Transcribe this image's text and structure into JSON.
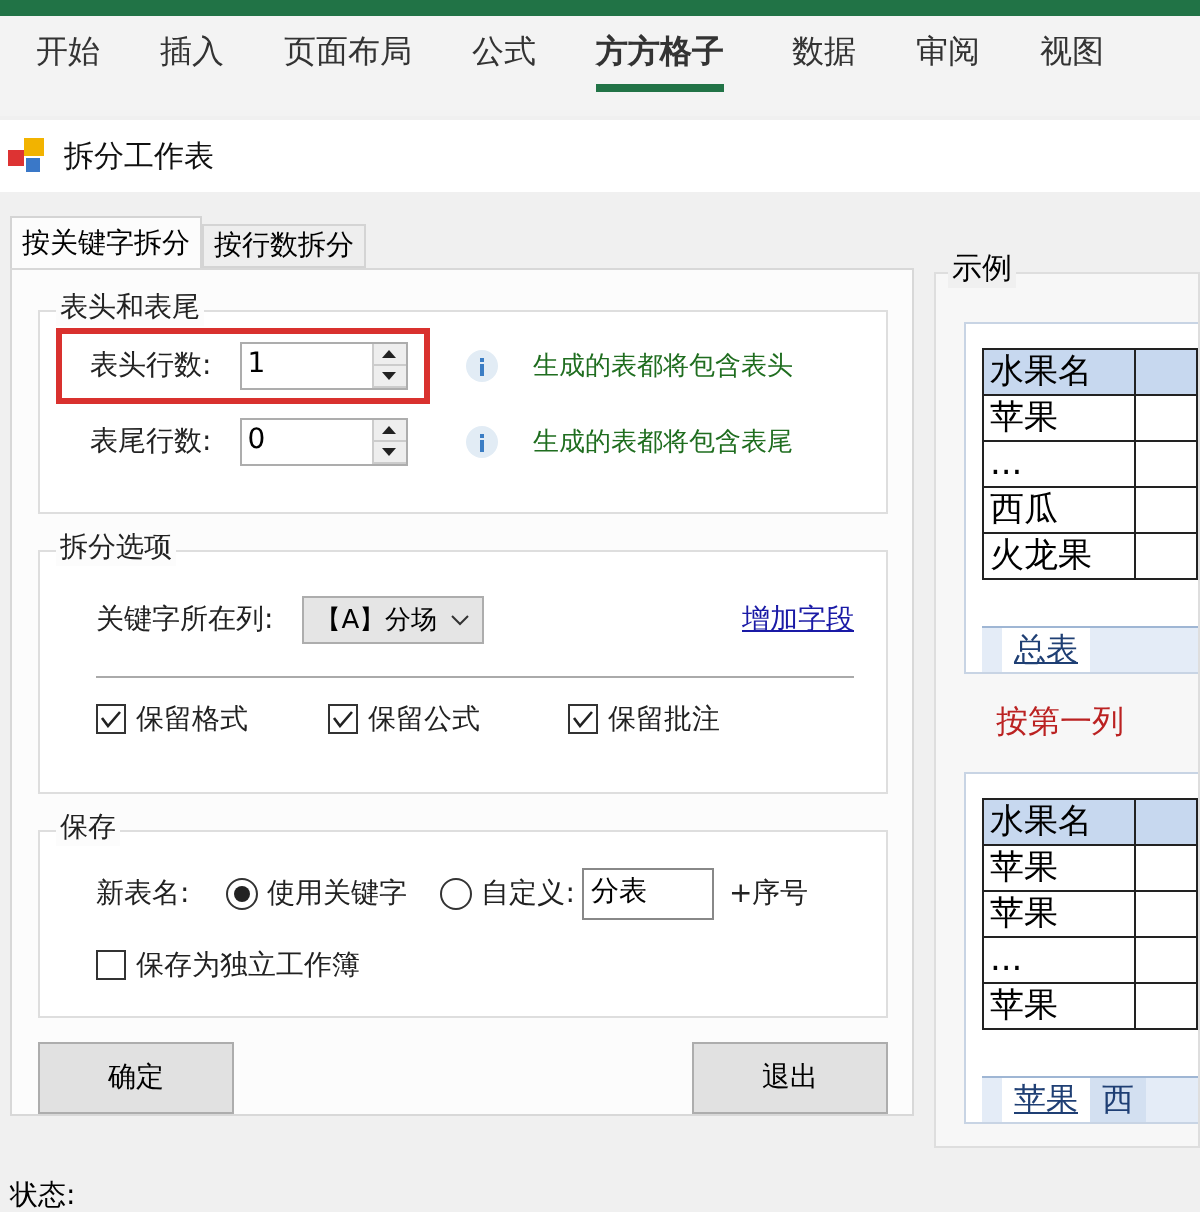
{
  "ribbon": {
    "tabs": [
      {
        "label": "开始",
        "selected": false
      },
      {
        "label": "插入",
        "selected": false
      },
      {
        "label": "页面布局",
        "selected": false
      },
      {
        "label": "公式",
        "selected": false
      },
      {
        "label": "方方格子",
        "selected": true
      },
      {
        "label": "数据",
        "selected": false
      },
      {
        "label": "审阅",
        "selected": false
      },
      {
        "label": "视图",
        "selected": false
      }
    ]
  },
  "dialog": {
    "title": "拆分工作表",
    "tabs": [
      {
        "label": "按关键字拆分",
        "selected": true
      },
      {
        "label": "按行数拆分",
        "selected": false
      }
    ],
    "header_footer": {
      "title": "表头和表尾",
      "rows": [
        {
          "label": "表头行数:",
          "value": "1",
          "highlighted": true,
          "hint": "生成的表都将包含表头"
        },
        {
          "label": "表尾行数:",
          "value": "0",
          "highlighted": false,
          "hint": "生成的表都将包含表尾"
        }
      ]
    },
    "split_options": {
      "title": "拆分选项",
      "key_column_label": "关键字所在列:",
      "key_column_value": "【A】分场",
      "add_field_link": "增加字段",
      "checkboxes": [
        {
          "label": "保留格式",
          "checked": true
        },
        {
          "label": "保留公式",
          "checked": true
        },
        {
          "label": "保留批注",
          "checked": true
        }
      ]
    },
    "save": {
      "title": "保存",
      "new_name_label": "新表名:",
      "options": [
        {
          "label": "使用关键字",
          "selected": true
        },
        {
          "label": "自定义:",
          "selected": false
        }
      ],
      "custom_value": "分表",
      "suffix": "+序号",
      "separate_workbook": {
        "label": "保存为独立工作簿",
        "checked": false
      }
    },
    "buttons": [
      "确定",
      "退出"
    ],
    "example": {
      "title": "示例",
      "caption": "按第一列",
      "tables": [
        {
          "rows": [
            "水果名",
            "苹果",
            "...",
            "西瓜",
            "火龙果"
          ],
          "sheet_tabs": [
            {
              "label": "总表",
              "selected": true
            }
          ]
        },
        {
          "rows": [
            "水果名",
            "苹果",
            "苹果",
            "...",
            "苹果"
          ],
          "sheet_tabs": [
            {
              "label": "苹果",
              "selected": true
            },
            {
              "label": "西",
              "selected": false
            }
          ]
        }
      ]
    },
    "status_label": "状态:"
  }
}
